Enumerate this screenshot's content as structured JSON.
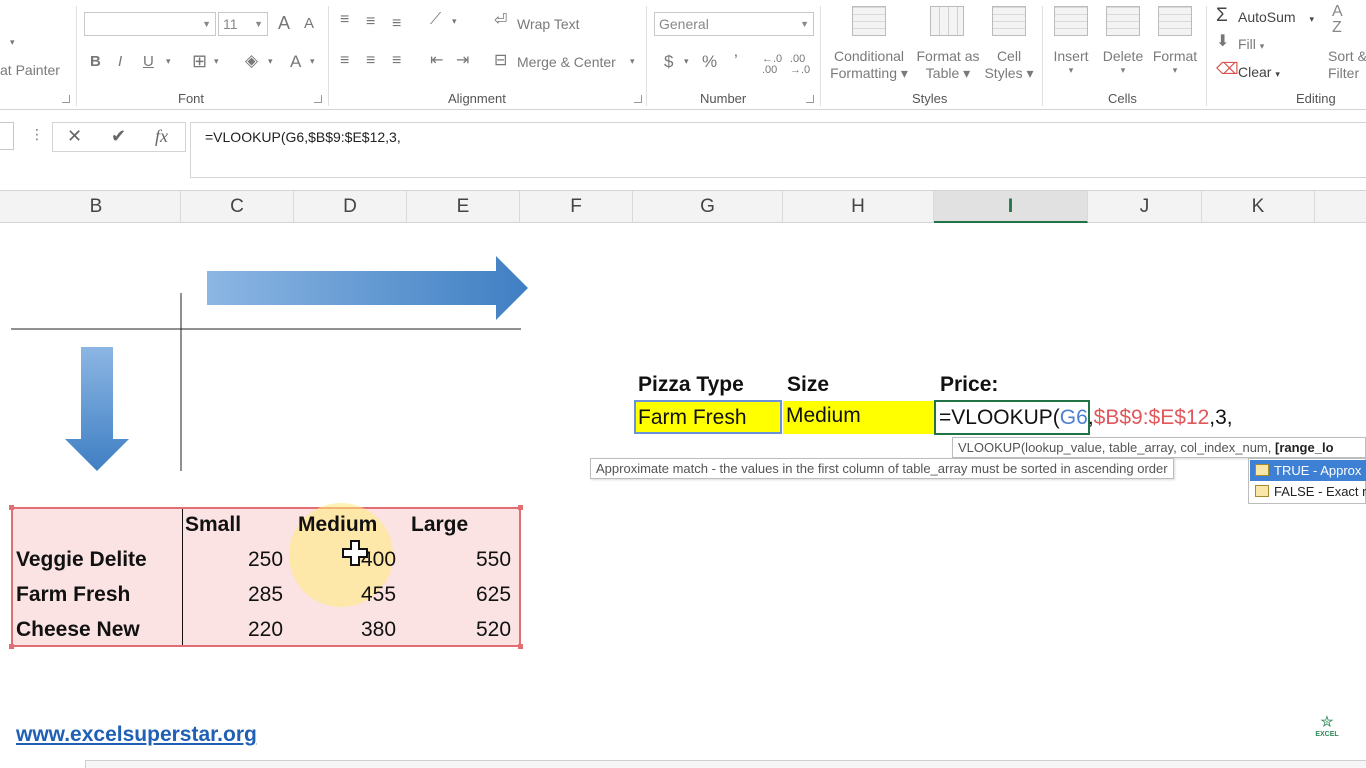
{
  "ribbon": {
    "clipboard": {
      "format_painter": "at Painter"
    },
    "font": {
      "font_size": "11",
      "bold": "B",
      "italic": "I",
      "underline": "U",
      "grow": "A",
      "shrink": "A",
      "font_color": "A",
      "group_label": "Font"
    },
    "alignment": {
      "wrap_text": "Wrap Text",
      "merge_center": "Merge & Center",
      "group_label": "Alignment"
    },
    "number": {
      "format": "General",
      "currency": "$",
      "percent": "%",
      "comma": "’",
      "group_label": "Number"
    },
    "styles": {
      "conditional_1": "Conditional",
      "conditional_2": "Formatting",
      "format_table_1": "Format as",
      "format_table_2": "Table",
      "cell_styles_1": "Cell",
      "cell_styles_2": "Styles",
      "group_label": "Styles"
    },
    "cells": {
      "insert": "Insert",
      "delete": "Delete",
      "format": "Format",
      "group_label": "Cells"
    },
    "editing": {
      "autosum": "AutoSum",
      "fill": "Fill",
      "clear": "Clear",
      "sort_1": "Sort &",
      "sort_2": "Filter",
      "group_label": "Editing"
    }
  },
  "formula_bar": {
    "cancel": "✕",
    "enter": "✔",
    "fx": "fx",
    "formula": "=VLOOKUP(G6,$B$9:$E$12,3,"
  },
  "columns": [
    {
      "label": "B"
    },
    {
      "label": "C"
    },
    {
      "label": "D"
    },
    {
      "label": "E"
    },
    {
      "label": "F"
    },
    {
      "label": "G"
    },
    {
      "label": "H"
    },
    {
      "label": "I"
    },
    {
      "label": "J"
    },
    {
      "label": "K"
    }
  ],
  "lookup": {
    "pizza_type_label": "Pizza Type",
    "size_label": "Size",
    "price_label": "Price:",
    "pizza_type_value": "Farm Fresh",
    "size_value": "Medium",
    "formula_prefix": "=VLOOKUP(",
    "formula_ref1": "G6",
    "formula_sep1": ",",
    "formula_ref2": "$B$9:$E$12",
    "formula_rest": ",3,",
    "ref1_color": "#4f7fd1",
    "ref2_color": "#e0575c"
  },
  "tooltips": {
    "syntax_plain": "VLOOKUP(lookup_value, table_array, col_index_num, ",
    "syntax_bold": "[range_lo",
    "description": "Approximate match - the values in the first column of table_array must be sorted in ascending order"
  },
  "autocomplete": [
    {
      "label": "TRUE - Approx",
      "selected": true
    },
    {
      "label": "FALSE - Exact r",
      "selected": false
    }
  ],
  "price_table": {
    "headers": [
      "Small",
      "Medium",
      "Large"
    ],
    "rows": [
      {
        "name": "Veggie Delite",
        "values": [
          "250",
          "400",
          "550"
        ]
      },
      {
        "name": "Farm Fresh",
        "values": [
          "285",
          "455",
          "625"
        ]
      },
      {
        "name": "Cheese New",
        "values": [
          "220",
          "380",
          "520"
        ]
      }
    ]
  },
  "footer": {
    "website": "www.excelsuperstar.org",
    "logo_text": "EXCEL"
  },
  "colors": {
    "excel_green": "#217346",
    "yellow_fill": "#ffff00",
    "table_fill": "#fbe3e4",
    "table_border": "#e26e74",
    "arrow_blue": "#4a86c8"
  }
}
